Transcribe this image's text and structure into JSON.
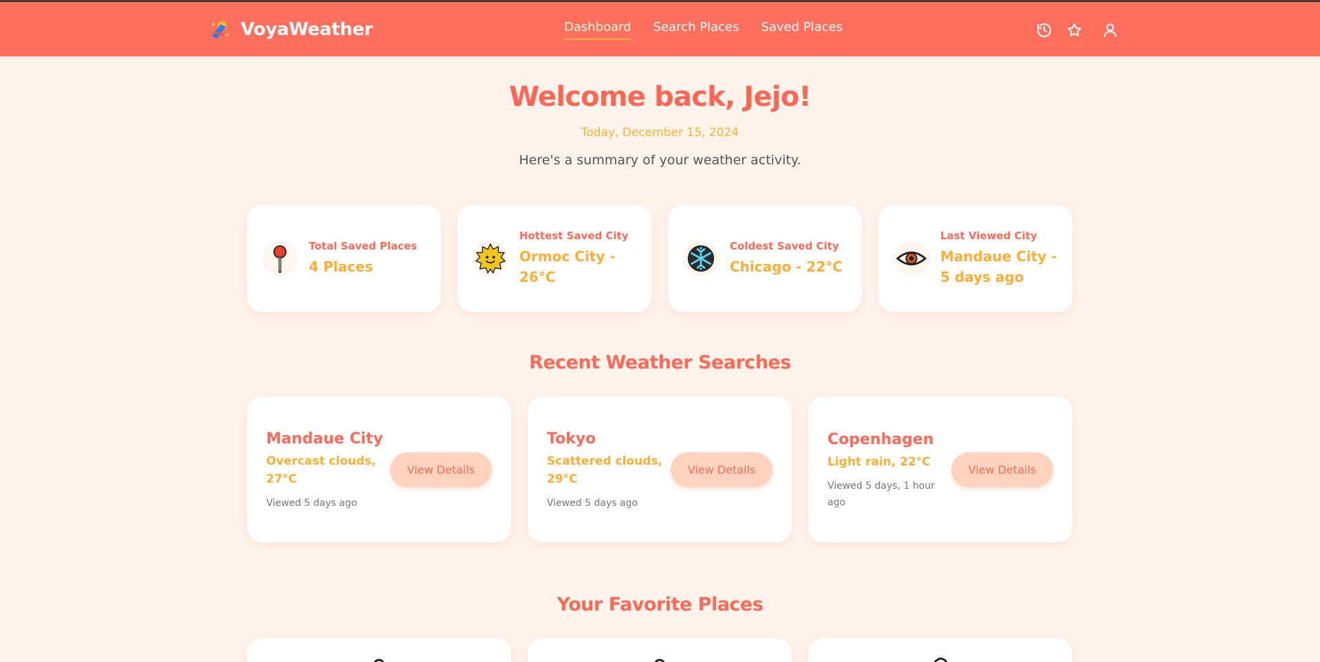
{
  "nav": {
    "brand": "VoyaWeather",
    "links": [
      {
        "label": "Dashboard",
        "active": true
      },
      {
        "label": "Search Places"
      },
      {
        "label": "Saved Places"
      }
    ],
    "icons": [
      "history-icon",
      "star-icon",
      "user-icon"
    ]
  },
  "header": {
    "welcome": "Welcome back, Jejo!",
    "date": "Today, December 15, 2024",
    "summary": "Here's a summary of your weather activity."
  },
  "stats": [
    {
      "label": "Total Saved Places",
      "value": "4 Places",
      "icon": "pushpin-icon"
    },
    {
      "label": "Hottest Saved City",
      "value": "Ormoc City - 26°C",
      "icon": "sun-icon"
    },
    {
      "label": "Coldest Saved City",
      "value": "Chicago - 22°C",
      "icon": "snowflake-icon"
    },
    {
      "label": "Last Viewed City",
      "value": "Mandaue City - 5 days ago",
      "icon": "eye-icon"
    }
  ],
  "recent": {
    "title": "Recent Weather Searches",
    "items": [
      {
        "city": "Mandaue City",
        "weather": "Overcast clouds, 27°C",
        "viewed": "Viewed 5 days ago",
        "button": "View Details"
      },
      {
        "city": "Tokyo",
        "weather": "Scattered clouds, 29°C",
        "viewed": "Viewed 5 days ago",
        "button": "View Details"
      },
      {
        "city": "Copenhagen",
        "weather": "Light rain, 22°C",
        "viewed": "Viewed 5 days, 1 hour ago",
        "button": "View Details"
      }
    ]
  },
  "favorites": {
    "title": "Your Favorite Places"
  },
  "colors": {
    "navbar": "#ff6f5e",
    "background": "#fff4ec",
    "primary": "#ff6a58",
    "accent": "#ffad33",
    "button": "#ffd3bd"
  }
}
